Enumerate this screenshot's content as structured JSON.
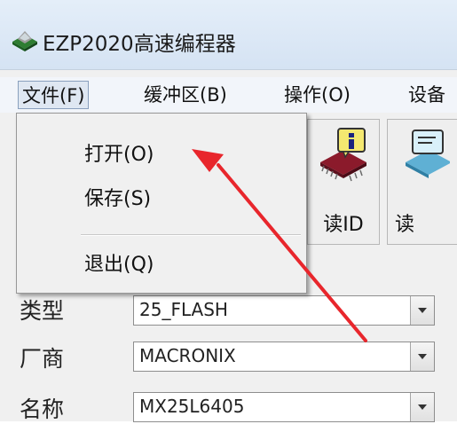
{
  "window": {
    "title": "EZP2020高速编程器"
  },
  "menubar": {
    "items": [
      {
        "label": "文件(F)"
      },
      {
        "label": "缓冲区(B)"
      },
      {
        "label": "操作(O)"
      },
      {
        "label": "设备"
      }
    ]
  },
  "file_menu": {
    "open_label": "打开(O)",
    "save_label": "保存(S)",
    "exit_label": "退出(Q)"
  },
  "toolbar": {
    "read_id_label": "读ID",
    "read_label": "读"
  },
  "form": {
    "type_label": "类型",
    "type_value": "25_FLASH",
    "vendor_label": "厂商",
    "vendor_value": "MACRONIX",
    "name_label": "名称",
    "name_value": "MX25L6405"
  },
  "colors": {
    "annotation_arrow": "#e8262c",
    "chip_body": "#8b1a2b",
    "info_badge": "#f4e870"
  },
  "icons": {
    "app": "chip-programmer-icon",
    "read_id": "chip-info-icon",
    "read": "chip-read-icon"
  }
}
